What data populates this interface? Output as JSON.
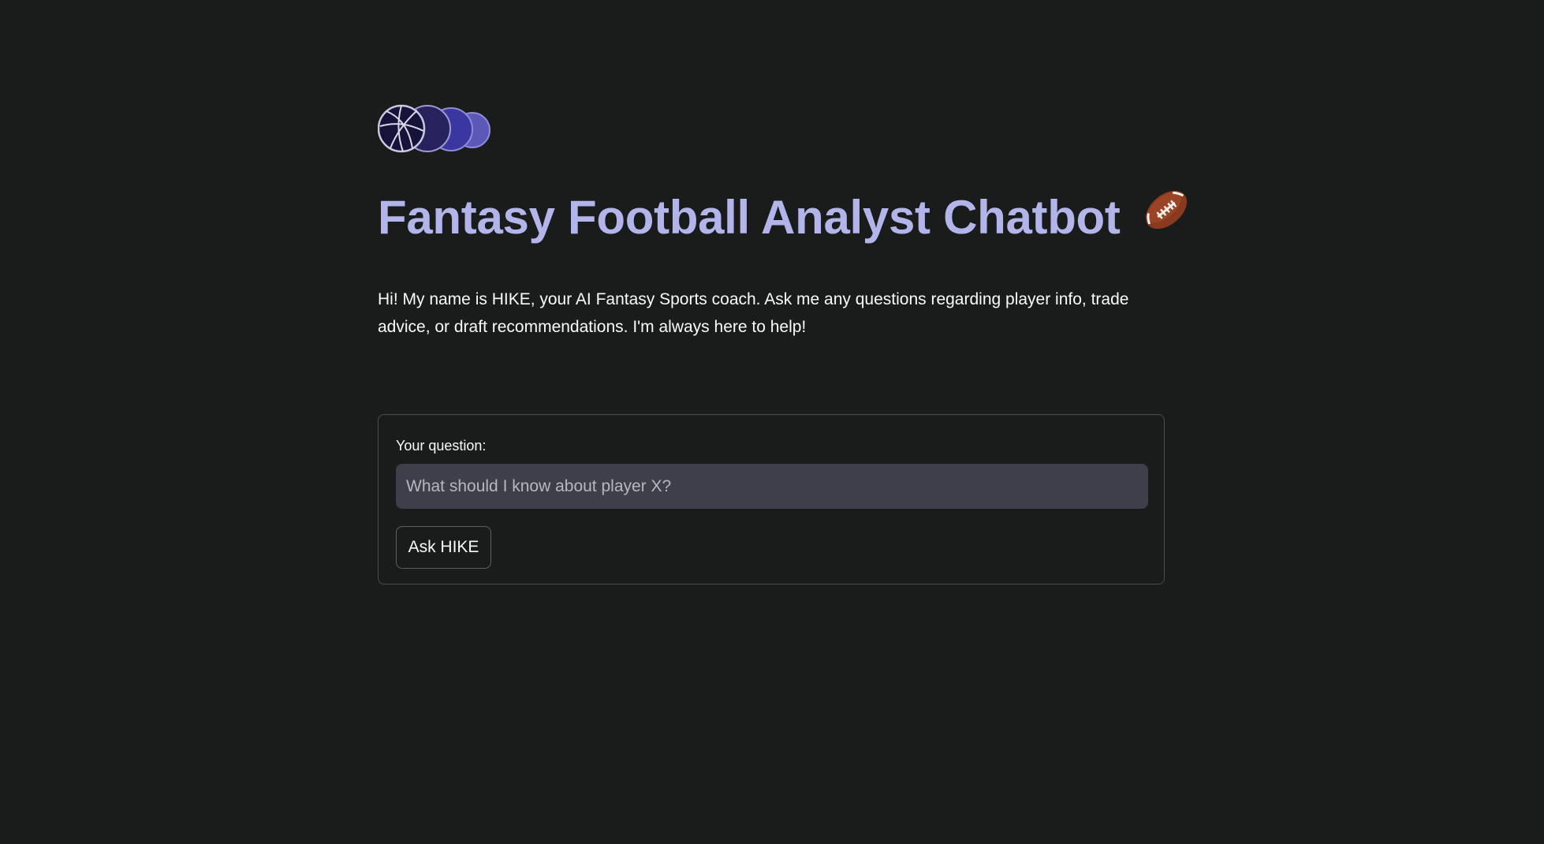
{
  "header": {
    "logo_icon": "sports-balls-logo-icon",
    "title": "Fantasy Football Analyst Chatbot",
    "title_emoji": "🏈",
    "title_color": "#b3b5ea"
  },
  "intro": {
    "text": "Hi! My name is HIKE, your AI Fantasy Sports coach. Ask me any questions regarding player info, trade advice, or draft recommendations. I'm always here to help!"
  },
  "form": {
    "question_label": "Your question:",
    "question_placeholder": "What should I know about player X?",
    "question_value": "",
    "submit_label": "Ask HIKE"
  },
  "theme": {
    "background": "#1a1c1c",
    "input_background": "#3e3f4a",
    "border": "#4a4c52"
  }
}
